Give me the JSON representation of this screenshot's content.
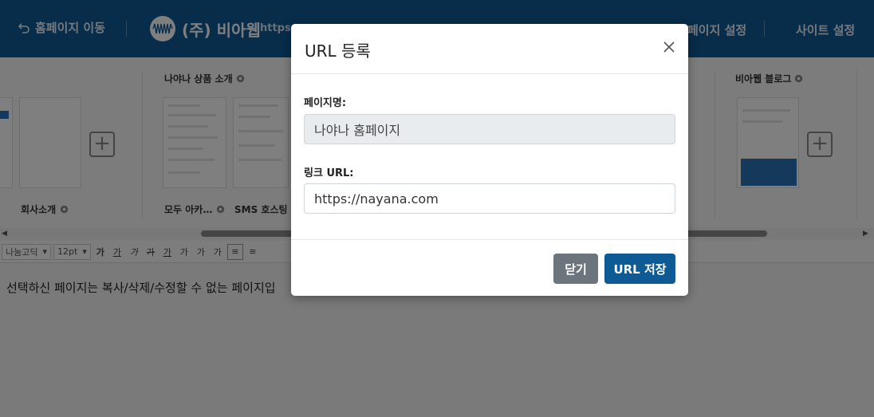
{
  "header": {
    "back_label": "홈페이지 이동",
    "company": "(주) 비아웹",
    "url_fragment": "https:",
    "settings_partial": "페이지 설정",
    "site_settings": "사이트 설정"
  },
  "strip": {
    "groups": [
      {
        "title": "나야나 상품 소개"
      },
      {
        "title": "비아웹 블로그"
      }
    ],
    "pages": [
      {
        "label": "회사소개"
      },
      {
        "label": "모두 아카…"
      },
      {
        "label": "SMS 호스팅"
      }
    ]
  },
  "toolbar": {
    "font": "나눔고딕",
    "size": "12pt",
    "bold": "가",
    "underline": "가",
    "italic": "가",
    "strike": "가",
    "color": "가",
    "bg": "가",
    "sup": "가",
    "sub": "가"
  },
  "editor": {
    "text": "선택하신 페이지는 복사/삭제/수정할 수 없는 페이지입"
  },
  "modal": {
    "title": "URL 등록",
    "page_name_label": "페이지명:",
    "page_name_value": "나야나 홈페이지",
    "link_url_label": "링크 URL:",
    "link_url_value": "https://nayana.com",
    "close_label": "닫기",
    "save_label": "URL 저장"
  },
  "colors": {
    "header_bg": "#0e5a95",
    "save_button": "#0e5a95",
    "close_button": "#6c757d"
  }
}
